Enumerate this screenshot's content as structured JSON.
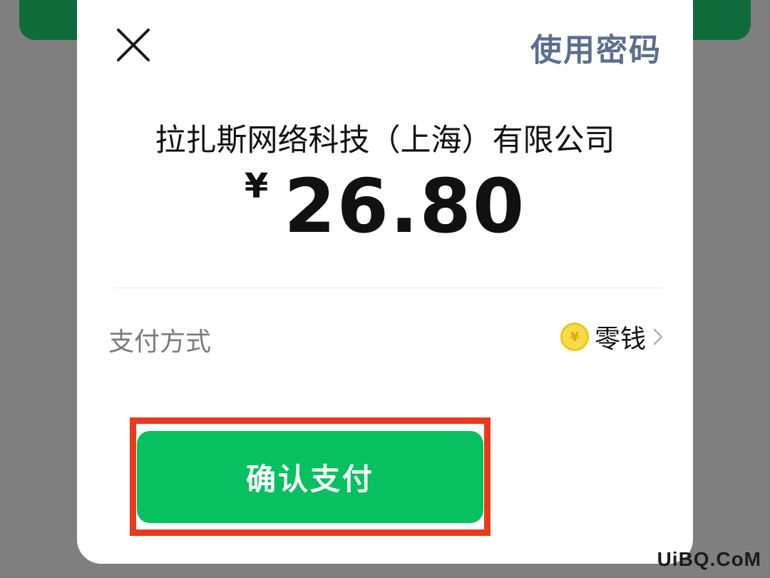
{
  "header": {
    "close_icon": "close-icon",
    "use_password_label": "使用密码"
  },
  "payment": {
    "merchant_name": "拉扎斯网络科技（上海）有限公司",
    "currency_symbol": "¥",
    "amount": "26.80"
  },
  "pay_method": {
    "label": "支付方式",
    "value": "零钱",
    "coin_symbol": "¥",
    "icon": "coin-icon",
    "chevron": "chevron-right-icon"
  },
  "confirm": {
    "label": "确认支付"
  },
  "watermark": {
    "text": "UiBQ.CoM"
  },
  "colors": {
    "accent_green": "#07c160",
    "link_blue_gray": "#5b6f8e",
    "highlight_red": "#ea3a1d",
    "background_dark_green": "#0f6b3a",
    "overlay_gray": "#7f7f7f"
  }
}
